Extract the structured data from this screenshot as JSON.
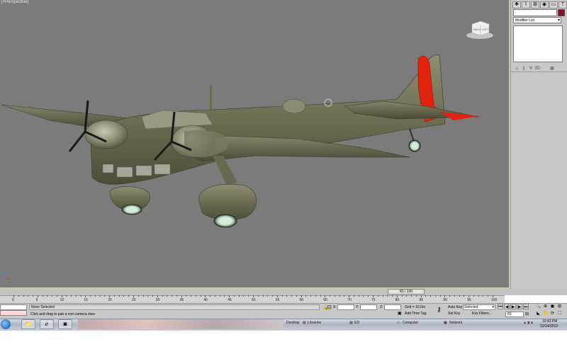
{
  "viewport": {
    "label": "[+Perspective]",
    "viewcube_left": "LEFT",
    "viewcube_back": "BACK"
  },
  "command_panel": {
    "tabs": [
      "create-icon",
      "modify-icon",
      "hierarchy-icon",
      "motion-icon",
      "display-icon",
      "utilities-icon"
    ],
    "object_name": "",
    "object_color": "#8a0f2a",
    "modifier_list": "Modifier List",
    "stack_tools": [
      "pin-stack-icon",
      "show-end-result-icon",
      "make-unique-icon",
      "remove-modifier-icon",
      "configure-sets-icon"
    ]
  },
  "timeline": {
    "slider_label": "83 / 100",
    "ticks": [
      "0",
      "5",
      "10",
      "15",
      "20",
      "25",
      "30",
      "35",
      "40",
      "45",
      "50",
      "55",
      "60",
      "65",
      "70",
      "75",
      "80",
      "85",
      "90",
      "95",
      "100"
    ]
  },
  "status": {
    "selection": "None Selected",
    "prompt": "Click and drag to pan a non-camera view",
    "x_label": "X:",
    "y_label": "Y:",
    "z_label": "Z:",
    "x_value": "",
    "y_value": "",
    "z_value": "",
    "grid": "Grid = 10.0m",
    "add_time_tag": "Add Time Tag",
    "auto_key": "Auto Key",
    "set_key": "Set Key",
    "selected_dropdown": "Selected",
    "key_filters": "Key Filters...",
    "current_frame": "83"
  },
  "taskbar": {
    "items": [
      "Desktop",
      "Libraries",
      "ED",
      "Computer",
      "Network"
    ],
    "time": "10:43 PM",
    "date": "12/14/2013"
  }
}
